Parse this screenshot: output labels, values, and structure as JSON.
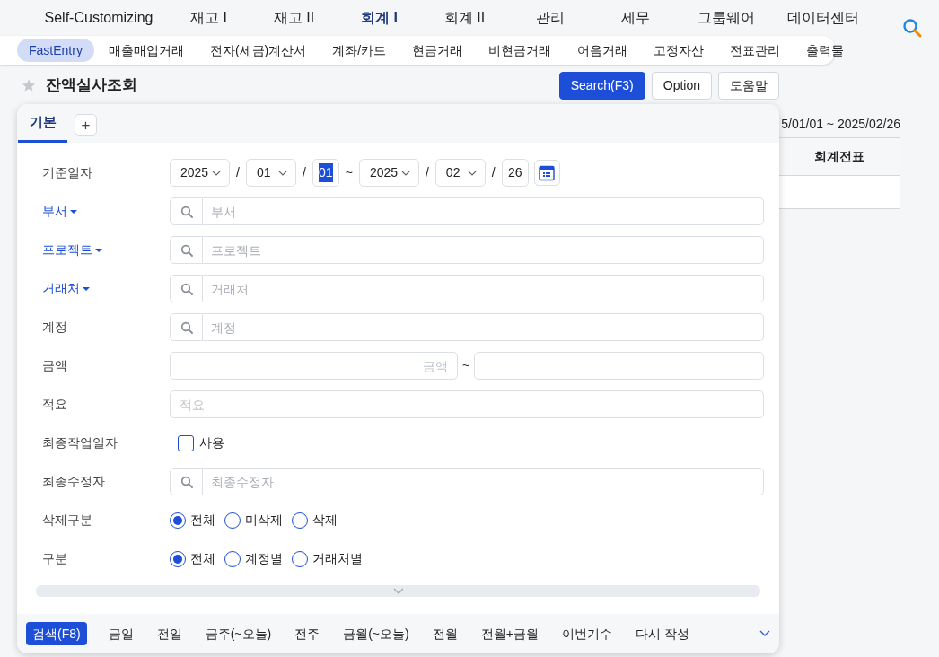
{
  "top_menu": [
    {
      "label": "Self-Customizing",
      "selected": false
    },
    {
      "label": "재고 I",
      "selected": false
    },
    {
      "label": "재고 II",
      "selected": false
    },
    {
      "label": "회계 I",
      "selected": true
    },
    {
      "label": "회계 II",
      "selected": false
    },
    {
      "label": "관리",
      "selected": false
    },
    {
      "label": "세무",
      "selected": false
    },
    {
      "label": "그룹웨어",
      "selected": false
    },
    {
      "label": "데이터센터",
      "selected": false
    }
  ],
  "sub_menu": [
    {
      "label": "FastEntry",
      "selected": true
    },
    {
      "label": "매출매입거래",
      "selected": false
    },
    {
      "label": "전자(세금)계산서",
      "selected": false
    },
    {
      "label": "계좌/카드",
      "selected": false
    },
    {
      "label": "현금거래",
      "selected": false
    },
    {
      "label": "비현금거래",
      "selected": false
    },
    {
      "label": "어음거래",
      "selected": false
    },
    {
      "label": "고정자산",
      "selected": false
    },
    {
      "label": "전표관리",
      "selected": false
    },
    {
      "label": "출력물",
      "selected": false
    }
  ],
  "page": {
    "title": "잔액실사조회",
    "favorite": false
  },
  "actions": [
    {
      "label": "Search(F3)",
      "kind": "primary"
    },
    {
      "label": "Option",
      "kind": "default"
    },
    {
      "label": "도움말",
      "kind": "default"
    }
  ],
  "background": {
    "date_range": "5/01/01 ~ 2025/02/26",
    "table_columns": [
      "회계전표"
    ]
  },
  "panel": {
    "tabs": [
      {
        "label": "기본",
        "selected": true
      }
    ],
    "add_tab": "+",
    "fields": [
      {
        "kind": "date_range",
        "label": "기준일자",
        "date_separator": "/",
        "range_separator": "~",
        "from": {
          "year": "2025",
          "month": "01",
          "day": "01",
          "day_highlighted": true
        },
        "to": {
          "year": "2025",
          "month": "02",
          "day": "26",
          "day_highlighted": false
        }
      },
      {
        "kind": "lookup",
        "label": "부서",
        "dropdown": true,
        "placeholder": "부서"
      },
      {
        "kind": "lookup",
        "label": "프로젝트",
        "dropdown": true,
        "placeholder": "프로젝트"
      },
      {
        "kind": "lookup",
        "label": "거래처",
        "dropdown": true,
        "placeholder": "거래처"
      },
      {
        "kind": "lookup",
        "label": "계정",
        "dropdown": false,
        "placeholder": "계정"
      },
      {
        "kind": "amount_range",
        "label": "금액",
        "placeholder": "금액",
        "separator": "~"
      },
      {
        "kind": "text",
        "label": "적요",
        "placeholder": "적요"
      },
      {
        "kind": "checkbox",
        "label": "최종작업일자",
        "option": "사용",
        "checked": false
      },
      {
        "kind": "lookup",
        "label": "최종수정자",
        "dropdown": false,
        "placeholder": "최종수정자"
      },
      {
        "kind": "radio",
        "label": "삭제구분",
        "options": [
          {
            "label": "전체",
            "selected": true
          },
          {
            "label": "미삭제",
            "selected": false
          },
          {
            "label": "삭제",
            "selected": false
          }
        ]
      },
      {
        "kind": "radio",
        "label": "구분",
        "options": [
          {
            "label": "전체",
            "selected": true
          },
          {
            "label": "계정별",
            "selected": false
          },
          {
            "label": "거래처별",
            "selected": false
          }
        ]
      }
    ],
    "footer": [
      {
        "label": "검색(F8)",
        "kind": "primary"
      },
      {
        "label": "금일",
        "kind": "default"
      },
      {
        "label": "전일",
        "kind": "default"
      },
      {
        "label": "금주(~오늘)",
        "kind": "default"
      },
      {
        "label": "전주",
        "kind": "default"
      },
      {
        "label": "금월(~오늘)",
        "kind": "default"
      },
      {
        "label": "전월",
        "kind": "default"
      },
      {
        "label": "전월+금월",
        "kind": "default"
      },
      {
        "label": "이번기수",
        "kind": "default"
      },
      {
        "label": "다시 작성",
        "kind": "default"
      }
    ]
  }
}
